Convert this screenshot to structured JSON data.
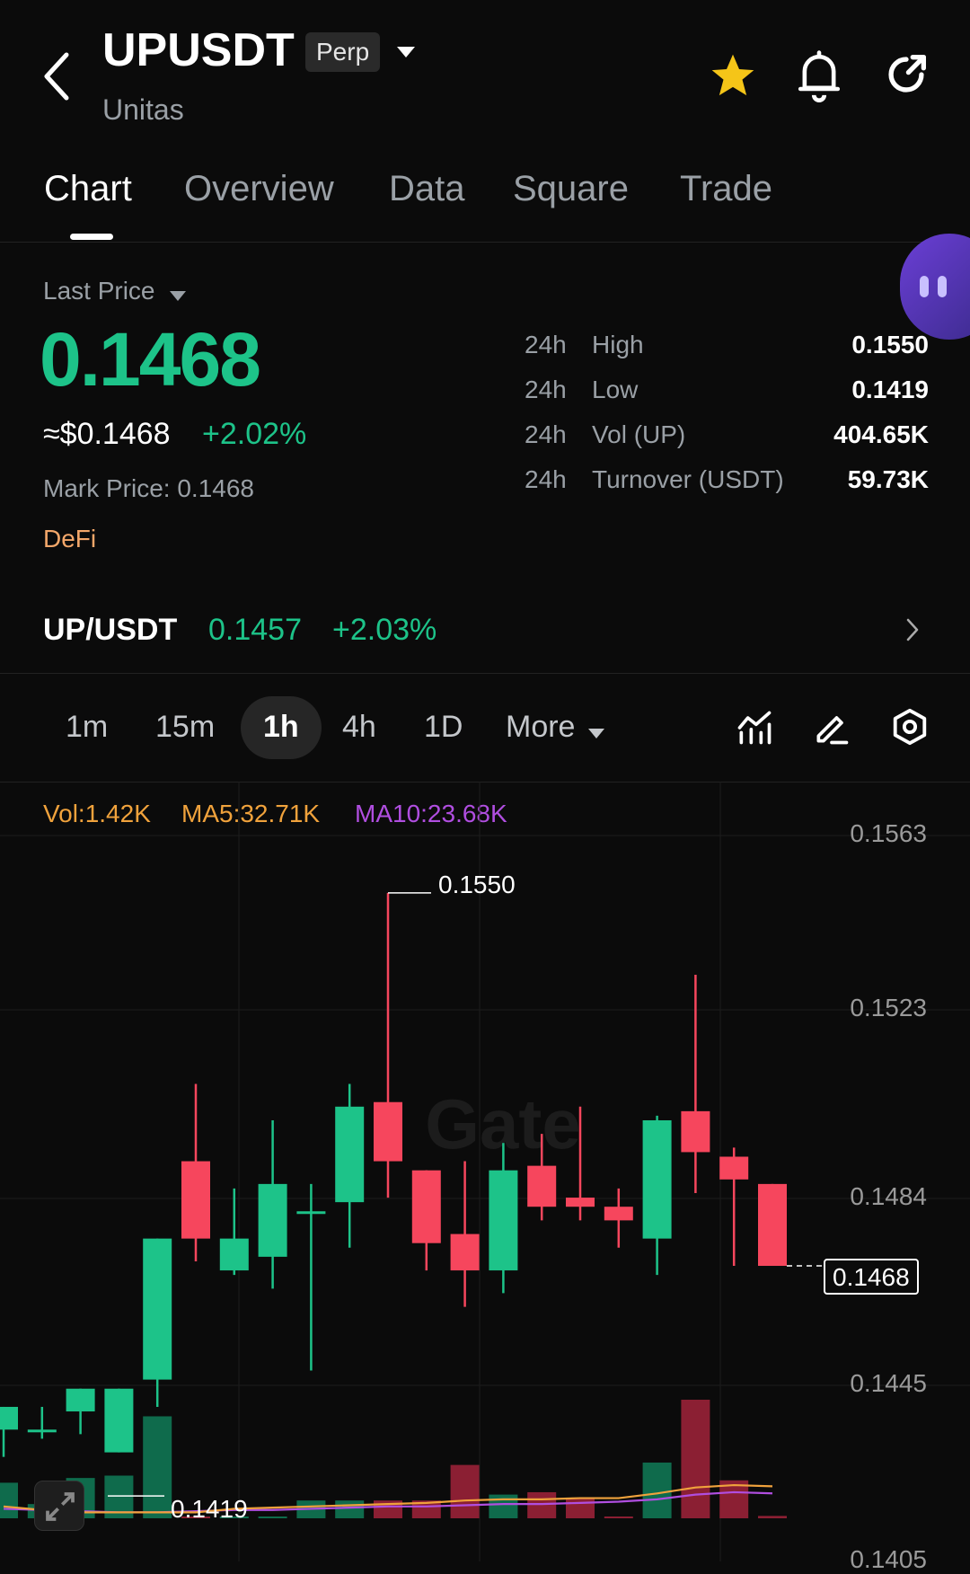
{
  "header": {
    "symbol": "UPUSDT",
    "badge": "Perp",
    "subtitle": "Unitas"
  },
  "tabs": [
    {
      "label": "Chart",
      "active": true
    },
    {
      "label": "Overview"
    },
    {
      "label": "Data"
    },
    {
      "label": "Square"
    },
    {
      "label": "Trade"
    }
  ],
  "price": {
    "type_label": "Last Price",
    "last": "0.1468",
    "usd": "≈$0.1468",
    "change": "+2.02%",
    "mark": "Mark Price: 0.1468",
    "tag": "DeFi"
  },
  "stats": [
    {
      "period": "24h",
      "label": "High",
      "value": "0.1550"
    },
    {
      "period": "24h",
      "label": "Low",
      "value": "0.1419"
    },
    {
      "period": "24h",
      "label": "Vol (UP)",
      "value": "404.65K"
    },
    {
      "period": "24h",
      "label": "Turnover (USDT)",
      "value": "59.73K"
    }
  ],
  "spot": {
    "pair": "UP/USDT",
    "price": "0.1457",
    "change": "+2.03%"
  },
  "timeframes": [
    "1m",
    "15m",
    "1h",
    "4h",
    "1D"
  ],
  "active_timeframe": "1h",
  "more_label": "More",
  "indicators": {
    "vol": "Vol:1.42K",
    "ma5": "MA5:32.71K",
    "ma10": "MA10:23.68K"
  },
  "colors": {
    "up": "#1dc389",
    "down": "#f6465d",
    "ma5": "#f0a23c",
    "ma10": "#b04ee0",
    "star": "#f5c518",
    "tag": "#f3a76a"
  },
  "chart_data": {
    "type": "candlestick",
    "y_ticks": [
      "0.1563",
      "0.1523",
      "0.1484",
      "0.1445",
      "0.1405"
    ],
    "ylim": [
      0.14045,
      0.157
    ],
    "high_label": "0.1550",
    "low_label": "0.1419",
    "last_label": "0.1468",
    "watermark": "Gate",
    "candles": [
      {
        "o": 0.1432,
        "h": 0.1434,
        "l": 0.1426,
        "c": 0.1437
      },
      {
        "o": 0.1432,
        "h": 0.1437,
        "l": 0.143,
        "c": 0.1432
      },
      {
        "o": 0.1436,
        "h": 0.1439,
        "l": 0.1431,
        "c": 0.1441
      },
      {
        "o": 0.1427,
        "h": 0.1441,
        "l": 0.1427,
        "c": 0.1441
      },
      {
        "o": 0.1443,
        "h": 0.1441,
        "l": 0.1437,
        "c": 0.1474
      },
      {
        "o": 0.1491,
        "h": 0.1508,
        "l": 0.1469,
        "c": 0.1474
      },
      {
        "o": 0.1467,
        "h": 0.1485,
        "l": 0.1466,
        "c": 0.1474
      },
      {
        "o": 0.147,
        "h": 0.15,
        "l": 0.1463,
        "c": 0.1486
      },
      {
        "o": 0.148,
        "h": 0.1486,
        "l": 0.1445,
        "c": 0.148
      },
      {
        "o": 0.1482,
        "h": 0.1508,
        "l": 0.1472,
        "c": 0.1503
      },
      {
        "o": 0.1504,
        "h": 0.155,
        "l": 0.1483,
        "c": 0.1491
      },
      {
        "o": 0.1489,
        "h": 0.1489,
        "l": 0.1467,
        "c": 0.1473
      },
      {
        "o": 0.1475,
        "h": 0.1491,
        "l": 0.1459,
        "c": 0.1467
      },
      {
        "o": 0.1467,
        "h": 0.1495,
        "l": 0.1462,
        "c": 0.1489
      },
      {
        "o": 0.149,
        "h": 0.1497,
        "l": 0.1478,
        "c": 0.1481
      },
      {
        "o": 0.1483,
        "h": 0.1503,
        "l": 0.1478,
        "c": 0.1481
      },
      {
        "o": 0.1481,
        "h": 0.1485,
        "l": 0.1472,
        "c": 0.1478
      },
      {
        "o": 0.1474,
        "h": 0.1501,
        "l": 0.1466,
        "c": 0.15
      },
      {
        "o": 0.1502,
        "h": 0.1532,
        "l": 0.1484,
        "c": 0.1493
      },
      {
        "o": 0.1492,
        "h": 0.1494,
        "l": 0.1468,
        "c": 0.1487
      },
      {
        "o": 0.1486,
        "h": 0.1486,
        "l": 0.1468,
        "c": 0.1468
      }
    ],
    "volume": [
      0.3,
      0.12,
      0.34,
      0.36,
      0.86,
      0.0,
      0.0,
      0.0,
      0.15,
      0.15,
      0.15,
      0.15,
      0.45,
      0.2,
      0.22,
      0.17,
      0.0,
      0.47,
      1.0,
      0.32,
      0.02
    ],
    "ma5": [
      0.1,
      0.07,
      0.05,
      0.05,
      0.05,
      0.05,
      0.08,
      0.09,
      0.1,
      0.11,
      0.12,
      0.13,
      0.15,
      0.16,
      0.16,
      0.17,
      0.17,
      0.21,
      0.26,
      0.28,
      0.27
    ],
    "ma10": [
      0.08,
      0.07,
      0.06,
      0.05,
      0.05,
      0.06,
      0.07,
      0.07,
      0.08,
      0.09,
      0.1,
      0.1,
      0.11,
      0.12,
      0.12,
      0.13,
      0.14,
      0.16,
      0.2,
      0.22,
      0.21
    ]
  }
}
